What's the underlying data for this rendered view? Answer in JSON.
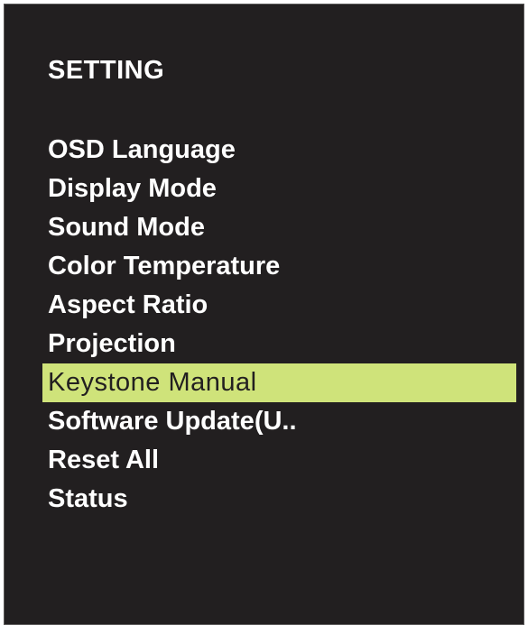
{
  "menu": {
    "title": "SETTING",
    "items": [
      {
        "label": "OSD Language"
      },
      {
        "label": "Display Mode"
      },
      {
        "label": "Sound Mode"
      },
      {
        "label": "Color Temperature"
      },
      {
        "label": "Aspect Ratio"
      },
      {
        "label": "Projection"
      },
      {
        "label": "Keystone Manual"
      },
      {
        "label": "Software Update(U.."
      },
      {
        "label": "Reset All"
      },
      {
        "label": "Status"
      }
    ],
    "selected_index": 6,
    "selected_label": "Keystone Manual"
  },
  "colors": {
    "background": "#221f20",
    "text": "#ffffff",
    "highlight": "#cfe37a",
    "highlight_text": "#221f20"
  }
}
